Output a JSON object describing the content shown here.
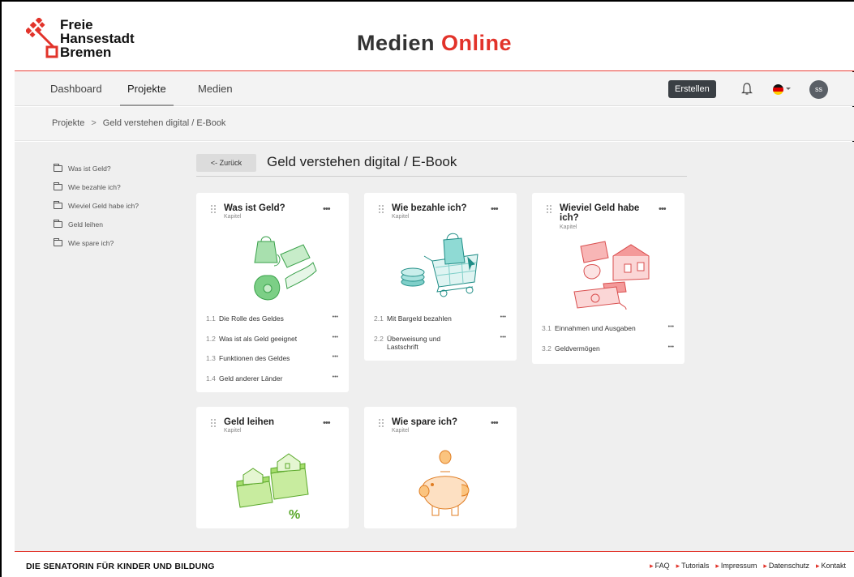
{
  "header": {
    "logo_lines": [
      "Freie",
      "Hansestadt",
      "Bremen"
    ],
    "brand_main": "Medien ",
    "brand_accent": "Online"
  },
  "nav": {
    "tabs": [
      "Dashboard",
      "Projekte",
      "Medien"
    ],
    "active_tab": "Projekte",
    "create_label": "Erstellen",
    "avatar_initials": "ss"
  },
  "breadcrumb": {
    "root": "Projekte",
    "separator": ">",
    "current": "Geld verstehen digital / E-Book"
  },
  "sidebar": {
    "items": [
      "Was ist Geld?",
      "Wie bezahle ich?",
      "Wieviel Geld habe ich?",
      "Geld leihen",
      "Wie spare ich?"
    ]
  },
  "content": {
    "back_label": "<- Zurück",
    "title": "Geld verstehen digital / E-Book",
    "card_type": "Kapitel",
    "more_label": "•••",
    "item_more_label": "•••",
    "cards": [
      {
        "title": "Was ist Geld?",
        "illustration": "money-bag-card-illustration",
        "color": "#5cc26b",
        "items": [
          {
            "num": "1.1",
            "label": "Die Rolle des Geldes"
          },
          {
            "num": "1.2",
            "label": "Was ist als Geld geeignet"
          },
          {
            "num": "1.3",
            "label": "Funktionen des Geldes"
          },
          {
            "num": "1.4",
            "label": "Geld anderer Länder"
          }
        ]
      },
      {
        "title": "Wie bezahle ich?",
        "illustration": "shopping-cart-illustration",
        "color": "#3fb7b0",
        "items": [
          {
            "num": "2.1",
            "label": "Mit Bargeld bezahlen"
          },
          {
            "num": "2.2",
            "label": "Überweisung und Lastschrift"
          }
        ]
      },
      {
        "title": "Wieviel Geld habe ich?",
        "illustration": "house-wallet-illustration",
        "color": "#f07f7f",
        "items": [
          {
            "num": "3.1",
            "label": "Einnahmen und Ausgaben"
          },
          {
            "num": "3.2",
            "label": "Geldvermögen"
          }
        ]
      },
      {
        "title": "Geld leihen",
        "illustration": "house-money-percent-illustration",
        "color": "#8fd14f",
        "items": []
      },
      {
        "title": "Wie spare ich?",
        "illustration": "piggy-bank-illustration",
        "color": "#f7a55a",
        "items": []
      }
    ]
  },
  "footer": {
    "title": "DIE SENATORIN FÜR KINDER UND BILDUNG",
    "links": [
      "FAQ",
      "Tutorials",
      "Impressum",
      "Datenschutz",
      "Kontakt"
    ]
  },
  "colors": {
    "accent": "#e2332a",
    "dark_button": "#3a3f44"
  }
}
